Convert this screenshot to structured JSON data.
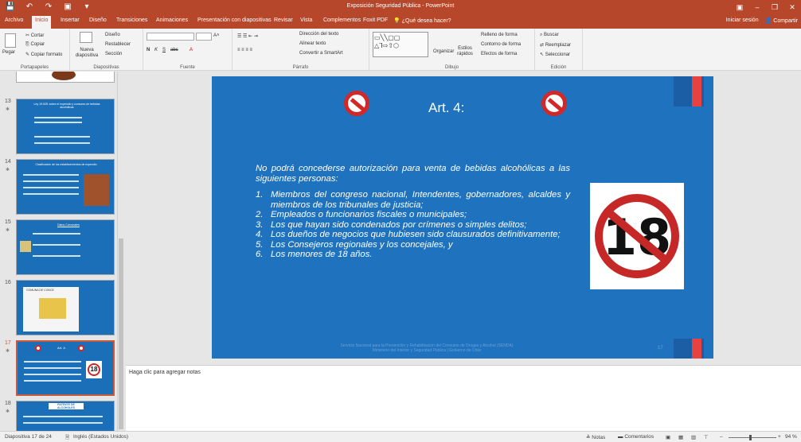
{
  "window": {
    "title": "Exposición Seguridad Pública - PowerPoint",
    "controls": [
      "▣",
      "–",
      "❐",
      "✕"
    ]
  },
  "qat": [
    "💾",
    "↶",
    "↷",
    "▣",
    "▾"
  ],
  "menu": {
    "tabs": [
      "Archivo",
      "Inicio",
      "Insertar",
      "Diseño",
      "Transiciones",
      "Animaciones",
      "Presentación con diapositivas",
      "Revisar",
      "Vista",
      "Complementos",
      "Foxit PDF"
    ],
    "tell_me": "¿Qué desea hacer?",
    "sign_in": "Iniciar sesión",
    "share": "Compartir"
  },
  "ribbon": {
    "clipboard": {
      "paste": "Pegar",
      "cut": "Cortar",
      "copy": "Copiar",
      "format": "Copiar formato",
      "label": "Portapapeles"
    },
    "slides": {
      "new": "Nueva diapositiva",
      "layout": "Diseño",
      "reset": "Restablecer",
      "section": "Sección",
      "label": "Diapositivas"
    },
    "font": {
      "bold": "N",
      "italic": "K",
      "underline": "S",
      "strike": "abc",
      "label": "Fuente"
    },
    "paragraph": {
      "direction": "Dirección del texto",
      "align": "Alinear texto",
      "smartart": "Convertir a SmartArt",
      "label": "Párrafo"
    },
    "drawing": {
      "arrange": "Organizar",
      "styles": "Estilos rápidos",
      "fill": "Relleno de forma",
      "outline": "Contorno de forma",
      "effects": "Efectos de forma",
      "label": "Dibujo"
    },
    "editing": {
      "find": "Buscar",
      "replace": "Reemplazar",
      "select": "Seleccionar",
      "label": "Edición"
    }
  },
  "thumbnails": [
    {
      "num": "13",
      "title": "Ley 19.925: sobre el expendio y consumo de bebidas alcohólicas"
    },
    {
      "num": "14",
      "title": "Clasificación de los establecimientos de expendio"
    },
    {
      "num": "15",
      "title": "Datos Comunales"
    },
    {
      "num": "16",
      "title": "COMUNA DE CONCE"
    },
    {
      "num": "17",
      "title": "Art. 4:"
    },
    {
      "num": "18",
      "title": "PATENTE DE ALCOHOLES"
    }
  ],
  "slide": {
    "title": "Art. 4:",
    "intro": "No podrá concederse autorización para venta de bebidas alcohólicas a las siguientes personas:",
    "items": [
      {
        "n": "1.",
        "text": "Miembros del congreso nacional, Intendentes, gobernadores, alcaldes y miembros de los tribunales de justicia;"
      },
      {
        "n": "2.",
        "text": "Empleados o funcionarios fiscales o municipales;"
      },
      {
        "n": "3.",
        "text": "Los que hayan sido condenados por crímenes o simples delitos;"
      },
      {
        "n": "4.",
        "text": "Los dueños de negocios que hubiesen sido clausurados definitivamente;"
      },
      {
        "n": "5.",
        "text": "Los Consejeros regionales y los concejales, y"
      },
      {
        "n": "6.",
        "text": "Los menores de 18 años."
      }
    ],
    "picture_number": "18",
    "footer_line1": "Servicio Nacional para la Prevención y Rehabilitación del Consumo de Drogas y Alcohol (SENDA)",
    "footer_line2": "Ministerio del Interior y Seguridad Pública | Gobierno de Chile",
    "slide_number": "17"
  },
  "notes_placeholder": "Haga clic para agregar notas",
  "status": {
    "slide_info": "Diapositiva 17 de 24",
    "language": "Inglés (Estados Unidos)",
    "notes": "Notas",
    "comments": "Comentarios",
    "zoom": "94 %"
  },
  "colors": {
    "accent": "#b7472a",
    "slide_bg": "#1e72be",
    "no_sign": "#d32828"
  }
}
